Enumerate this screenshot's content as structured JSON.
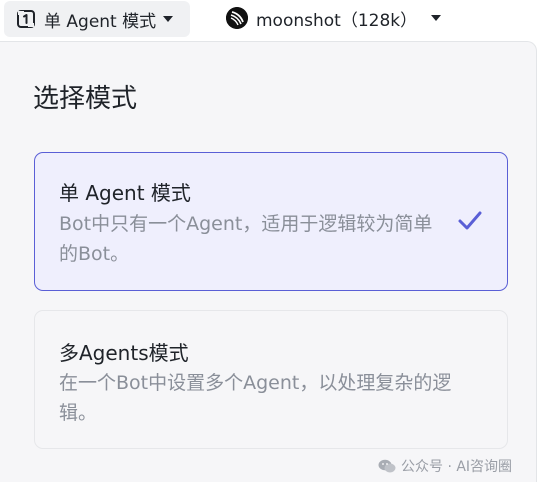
{
  "toolbar": {
    "mode_select": {
      "label": "单 Agent 模式",
      "icon": "agent-mode-icon"
    },
    "model_select": {
      "label": "moonshot（128k）",
      "icon": "moonshot-logo"
    }
  },
  "panel": {
    "title": "选择模式",
    "options": [
      {
        "title": "单 Agent 模式",
        "description": "Bot中只有一个Agent，适用于逻辑较为简单的Bot。",
        "selected": true,
        "icon": "check-icon"
      },
      {
        "title": "多Agents模式",
        "description": "在一个Bot中设置多个Agent，以处理复杂的逻辑。",
        "selected": false
      }
    ]
  },
  "watermark": {
    "text": "公众号 · AI咨询圈",
    "icon": "wechat-icon"
  },
  "colors": {
    "accent": "#5a5fd6",
    "selected_bg": "#efeffd",
    "panel_bg": "#f6f6f8",
    "muted_text": "#8a8f99"
  }
}
